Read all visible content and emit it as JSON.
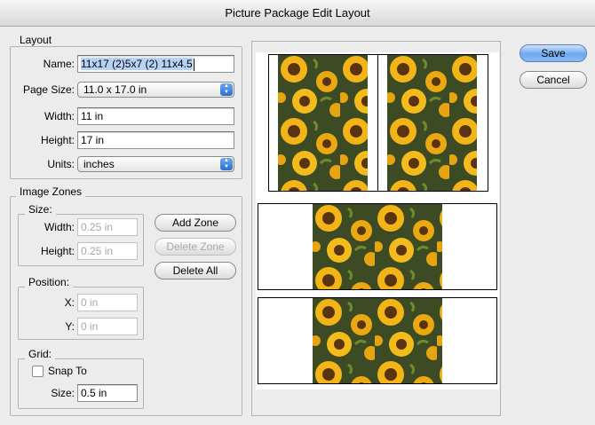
{
  "window": {
    "title": "Picture Package Edit Layout"
  },
  "layout": {
    "legend": "Layout",
    "name": {
      "label": "Name:",
      "value": "11x17 (2)5x7 (2) 11x4.5"
    },
    "page_size": {
      "label": "Page Size:",
      "value": "11.0 x 17.0 in"
    },
    "width": {
      "label": "Width:",
      "value": "11 in"
    },
    "height": {
      "label": "Height:",
      "value": "17 in"
    },
    "units": {
      "label": "Units:",
      "value": "inches"
    }
  },
  "image_zones": {
    "legend": "Image Zones",
    "size": {
      "legend": "Size:",
      "width": {
        "label": "Width:",
        "value": "0.25 in"
      },
      "height": {
        "label": "Height:",
        "value": "0.25 in"
      }
    },
    "position": {
      "legend": "Position:",
      "x": {
        "label": "X:",
        "value": "0 in"
      },
      "y": {
        "label": "Y:",
        "value": "0 in"
      }
    },
    "buttons": {
      "add": "Add Zone",
      "delete": "Delete Zone",
      "delete_all": "Delete All"
    }
  },
  "grid": {
    "legend": "Grid:",
    "snap_to": {
      "label": "Snap To",
      "checked": false
    },
    "size": {
      "label": "Size:",
      "value": "0.5 in"
    }
  },
  "actions": {
    "save": "Save",
    "cancel": "Cancel"
  },
  "preview": {
    "zone_count": 4,
    "image": "sunflower-photo"
  },
  "colors": {
    "accent": "#6ea9ef",
    "selection": "#b6d3f5"
  }
}
